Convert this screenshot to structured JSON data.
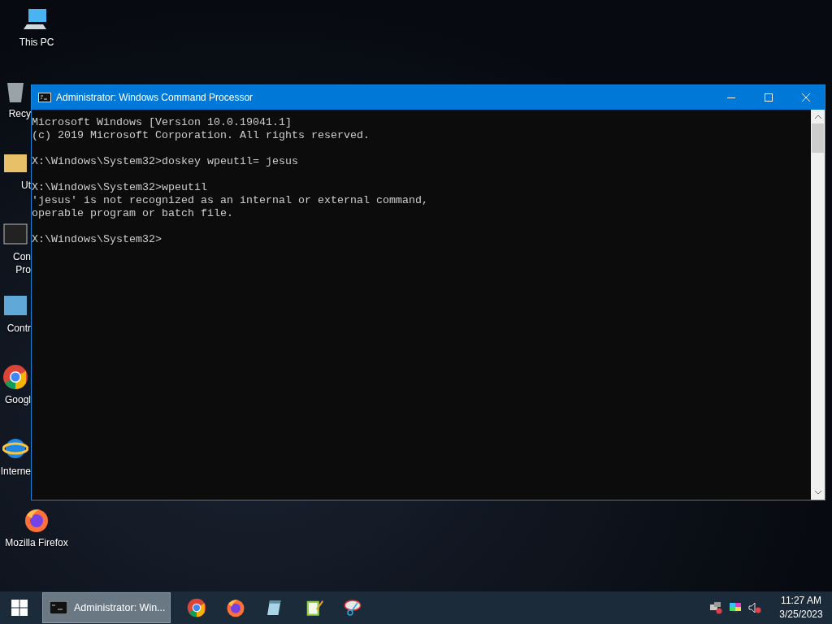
{
  "desktop_icons": [
    {
      "kind": "pc",
      "lines": [
        "This PC"
      ]
    },
    {
      "kind": "recycle",
      "lines": [
        "Recy"
      ]
    },
    {
      "kind": "folder",
      "lines": [
        "Ut"
      ]
    },
    {
      "kind": "console",
      "lines": [
        "Con",
        "Pro"
      ]
    },
    {
      "kind": "panel",
      "lines": [
        "Contr"
      ]
    },
    {
      "kind": "chrome",
      "lines": [
        "Googl"
      ]
    },
    {
      "kind": "ie",
      "lines": [
        "Interne"
      ]
    },
    {
      "kind": "firefox",
      "lines": [
        "Mozilla Firefox"
      ]
    }
  ],
  "window": {
    "title": "Administrator: Windows Command Processor",
    "console_blocks": [
      [
        "Microsoft Windows [Version 10.0.19041.1]",
        "(c) 2019 Microsoft Corporation. All rights reserved."
      ],
      [
        "X:\\Windows\\System32>doskey wpeutil= jesus"
      ],
      [
        "X:\\Windows\\System32>wpeutil",
        "'jesus' is not recognized as an internal or external command,",
        "operable program or batch file."
      ],
      [
        "X:\\Windows\\System32>"
      ]
    ]
  },
  "taskbar": {
    "task": {
      "label": "Administrator: Win...",
      "selected": true
    },
    "pinned": [
      {
        "kind": "chrome"
      },
      {
        "kind": "firefox"
      },
      {
        "kind": "notepad"
      },
      {
        "kind": "editor"
      },
      {
        "kind": "snip"
      }
    ],
    "tray": [
      {
        "kind": "network"
      },
      {
        "kind": "display"
      },
      {
        "kind": "volume"
      }
    ],
    "time": "11:27 AM",
    "date": "3/25/2023"
  }
}
